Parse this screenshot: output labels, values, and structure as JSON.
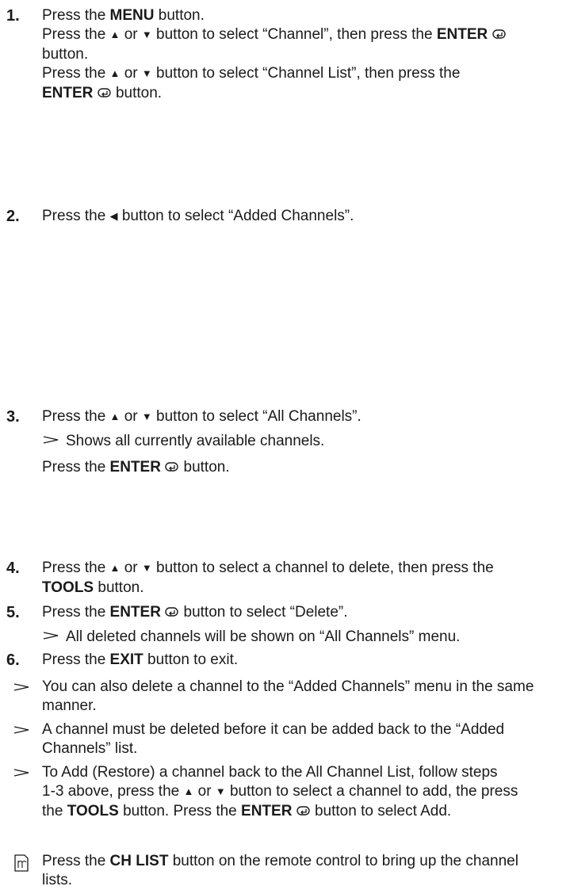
{
  "steps": [
    {
      "number": "1.",
      "lines": [
        [
          "Press the ",
          "MENU",
          " button."
        ],
        [
          "Press the ",
          "▲",
          " or ",
          "▼",
          " button to select “Channel”, then press the ",
          "ENTER",
          ""
        ],
        [
          "button."
        ],
        [
          "Press the ",
          "▲",
          " or ",
          "▼",
          " button to select “Channel List”, then press the"
        ],
        [
          "ENTER",
          "",
          " button."
        ]
      ]
    },
    {
      "number": "2.",
      "text_a": "Press the ",
      "left_arrow": "◀",
      "text_b": " button to select “Added Channels”."
    },
    {
      "number": "3.",
      "text_a": "Press the ",
      "up": "▲",
      "or": " or ",
      "down": "▼",
      "text_b": " button to select “All Channels”.",
      "note": "Shows all currently available channels.",
      "line2_a": "Press the ",
      "line2_enter": "ENTER",
      "line2_b": " button."
    },
    {
      "number": "4.",
      "text_a": "Press the ",
      "up": "▲",
      "or": " or ",
      "down": "▼",
      "text_b": " button to select a channel to delete, then press the",
      "tools": "TOOLS",
      "text_c": " button."
    },
    {
      "number": "5.",
      "text_a": "Press the ",
      "enter": "ENTER",
      "text_b": " button to select “Delete”.",
      "note": "All deleted channels will be shown on “All Channels” menu."
    },
    {
      "number": "6.",
      "text_a": "Press the ",
      "exit": "EXIT",
      "text_b": " button to exit."
    }
  ],
  "notes": [
    {
      "line1": "You can also delete a channel to the “Added Channels” menu in the same",
      "line2": "manner."
    },
    {
      "line1": "A channel must be deleted before it can be added back to the “Added",
      "line2": "Channels” list."
    },
    {
      "line1": "To Add (Restore) a channel back to the All Channel List, follow steps",
      "line2_a": "1-3 above, press the ",
      "up": "▲",
      "or": " or ",
      "down": "▼",
      "line2_b": " button to select a channel to add, the press",
      "line3_a": "the ",
      "tools": "TOOLS",
      "line3_b": " button. Press the ",
      "enter": "ENTER",
      "line3_c": " button to select Add."
    }
  ],
  "memo": {
    "text_a": "Press the ",
    "chlist": "CH LIST",
    "text_b": " button on the remote control to bring up the channel",
    "line2": "lists."
  },
  "icons": {
    "enter": "enter-icon",
    "note_arrow": "arrow-note-icon",
    "memo": "memo-icon"
  }
}
